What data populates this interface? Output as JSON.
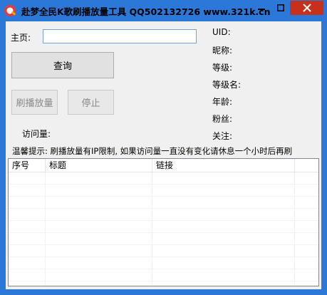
{
  "window": {
    "title": "赴梦全民K歌刷播放量工具 QQ502132726  www.321k.cn"
  },
  "form": {
    "homepage_label": "主页:",
    "homepage_value": "",
    "query_label": "查询",
    "brush_label": "刷播放量",
    "stop_label": "停止",
    "visits_label": "访问量:"
  },
  "info": {
    "uid": "UID:",
    "nickname": "昵称:",
    "level": "等级:",
    "level_name": "等级名:",
    "age": "年龄:",
    "fans": "粉丝:",
    "follow": "关注:"
  },
  "tip": "温馨提示: 刷播放量有IP限制, 如果访问量一直没有变化请休息一个小时后再刷",
  "table": {
    "columns": [
      "序号",
      "标题",
      "链接"
    ],
    "rows": []
  },
  "colors": {
    "titlebar": "#2b78d8",
    "close": "#c7311c",
    "client": "#f0f0f0"
  }
}
